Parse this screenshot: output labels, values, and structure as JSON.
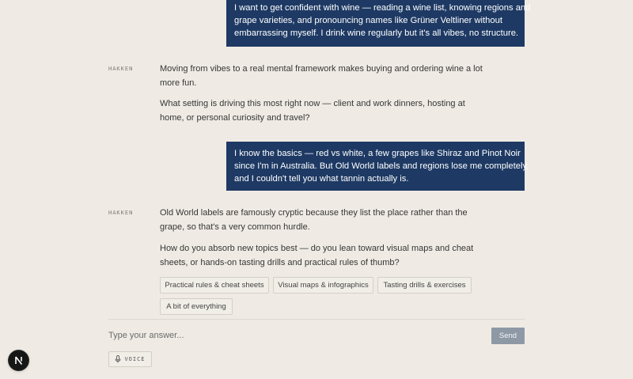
{
  "messages": [
    {
      "role": "user",
      "lines": [
        "I want to get confident with wine — reading a wine list, knowing regions and",
        "grape varieties, and pronouncing names like Grüner Veltliner without",
        "embarrassing myself. I drink wine regularly but it's all vibes, no structure."
      ]
    },
    {
      "role": "assistant",
      "speaker": "HAKKEN",
      "paragraphs": [
        [
          "Moving from vibes to a real mental framework makes buying and ordering wine a lot",
          "more fun."
        ],
        [
          "What setting is driving this most right now — client and work dinners, hosting at",
          "home, or personal curiosity and travel?"
        ]
      ]
    },
    {
      "role": "user",
      "lines": [
        "I know the basics — red vs white, a few grapes like Shiraz and Pinot Noir",
        "since I'm in Australia. But Old World labels and regions lose me completely,",
        "and I couldn't tell you what tannin actually is."
      ]
    },
    {
      "role": "assistant",
      "speaker": "HAKKEN",
      "paragraphs": [
        [
          "Old World labels are famously cryptic because they list the place rather than the",
          "grape, so that's a very common hurdle."
        ],
        [
          "How do you absorb new topics best — do you lean toward visual maps and cheat",
          "sheets, or hands-on tasting drills and practical rules of thumb?"
        ]
      ],
      "options": [
        "Practical rules & cheat sheets",
        "Visual maps & infographics",
        "Tasting drills & exercises",
        "A bit of everything"
      ]
    }
  ],
  "composer": {
    "placeholder": "Type your answer...",
    "value": "",
    "send_label": "Send",
    "voice_label": "VOICE",
    "voice_icon": "microphone-icon"
  },
  "nav_badge": {
    "letter": "N",
    "icon": "n-logo-icon"
  },
  "colors": {
    "background": "#efebe4",
    "user_bubble": "#1e3a64",
    "send_button": "#8e99a6",
    "badge": "#161616"
  }
}
